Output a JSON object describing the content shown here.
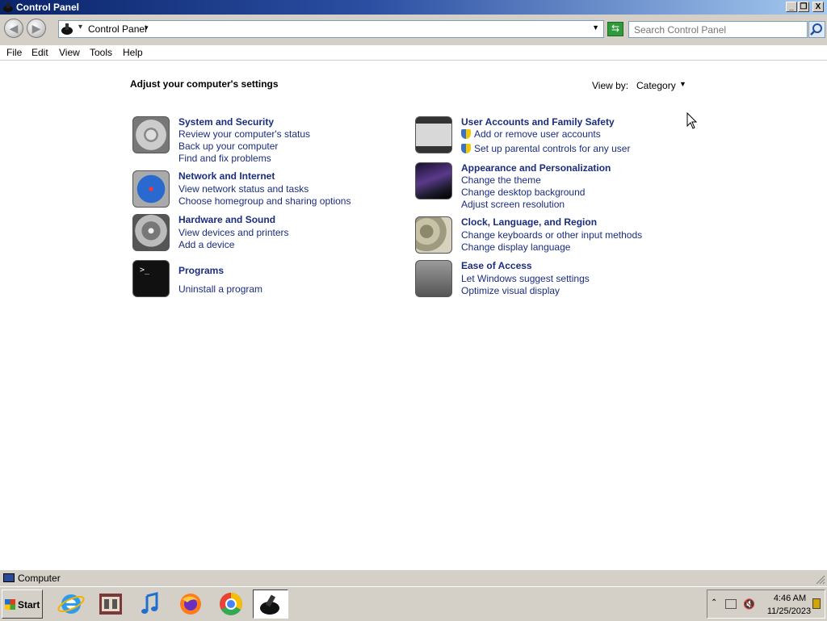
{
  "window": {
    "title": "Control Panel",
    "buttons": {
      "minimize": "_",
      "maximize": "❐",
      "close": "X"
    }
  },
  "toolbar": {
    "back_icon": "back-arrow-icon",
    "forward_icon": "forward-arrow-icon",
    "breadcrumb": "Control Panel",
    "search_placeholder": "Search Control Panel"
  },
  "menu": [
    "File",
    "Edit",
    "View",
    "Tools",
    "Help"
  ],
  "content": {
    "heading": "Adjust your computer's settings",
    "view_by_label": "View by:",
    "view_by_value": "Category",
    "categories_left": [
      {
        "title": "System and Security",
        "icon": "vault-icon",
        "links": [
          "Review your computer's status",
          "Back up your computer",
          "Find and fix problems"
        ]
      },
      {
        "title": "Network and Internet",
        "icon": "compass-icon",
        "links": [
          "View network status and tasks",
          "Choose homegroup and sharing options"
        ]
      },
      {
        "title": "Hardware and Sound",
        "icon": "dvd-drive-icon",
        "links": [
          "View devices and printers",
          "Add a device"
        ]
      },
      {
        "title": "Programs",
        "icon": "terminal-icon",
        "links": [
          "Uninstall a program"
        ]
      }
    ],
    "categories_right": [
      {
        "title": "User Accounts and Family Safety",
        "icon": "authorized-badge-icon",
        "links": [
          "Add or remove user accounts",
          "Set up parental controls for any user"
        ]
      },
      {
        "title": "Appearance and Personalization",
        "icon": "desktop-wallpaper-icon",
        "links": [
          "Change the theme",
          "Change desktop background",
          "Adjust screen resolution"
        ]
      },
      {
        "title": "Clock, Language, and Region",
        "icon": "world-map-icon",
        "links": [
          "Change keyboards or other input methods",
          "Change display language"
        ]
      },
      {
        "title": "Ease of Access",
        "icon": "people-icon",
        "links": [
          "Let Windows suggest settings",
          "Optimize visual display"
        ]
      }
    ]
  },
  "statusbar": {
    "text": "Computer"
  },
  "taskbar": {
    "start_label": "Start",
    "apps": [
      "internet-explorer-icon",
      "film-reel-icon",
      "itunes-icon",
      "firefox-icon",
      "chrome-icon",
      "control-panel-icon"
    ],
    "clock": {
      "time": "4:46 AM",
      "date": "11/25/2023"
    }
  },
  "colors": {
    "link": "#1a2d7e",
    "titlebar_start": "#0a246a",
    "chrome": "#d4d0c8"
  }
}
